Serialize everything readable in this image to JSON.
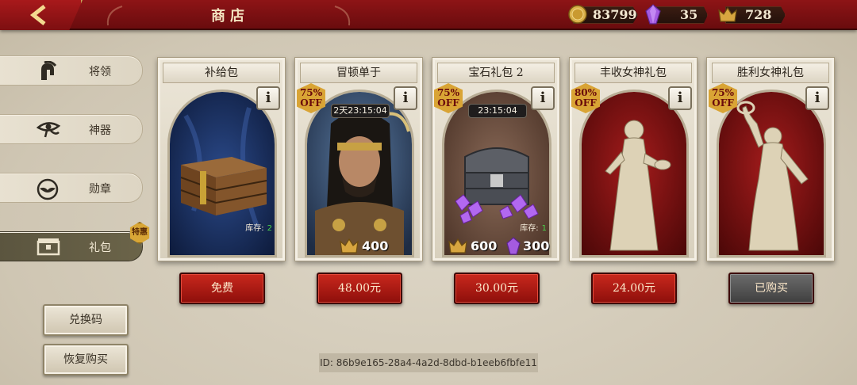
{
  "header": {
    "title": "商店",
    "currencies": [
      {
        "icon": "gold-coin-icon",
        "value": "83799"
      },
      {
        "icon": "purple-gem-icon",
        "value": "35"
      },
      {
        "icon": "crown-token-icon",
        "value": "728"
      }
    ]
  },
  "sidebar": {
    "items": [
      {
        "label": "将领",
        "icon": "spartan-helmet-icon"
      },
      {
        "label": "神器",
        "icon": "eye-of-horus-icon"
      },
      {
        "label": "勋章",
        "icon": "eagle-medal-icon"
      },
      {
        "label": "礼包",
        "icon": "gift-chest-icon"
      }
    ],
    "hot_badge": "特惠",
    "redeem_label": "兑换码",
    "restore_label": "恢复购买"
  },
  "cards": [
    {
      "title": "补给包",
      "art": "wooden-supply-chest",
      "stock_label": "库存:",
      "stock_value": "2",
      "button": "免费"
    },
    {
      "title": "冒顿单于",
      "art": "general-portrait",
      "off": "75%",
      "off_word": "OFF",
      "timer": "2天23:15:04",
      "reward_value": "400",
      "button": "48.00元"
    },
    {
      "title": "宝石礼包 2",
      "art": "gem-treasure-chest",
      "off": "75%",
      "off_word": "OFF",
      "timer": "23:15:04",
      "stock_label": "库存:",
      "stock_value": "1",
      "reward_value": "600",
      "gem_value": "300",
      "button": "30.00元"
    },
    {
      "title": "丰收女神礼包",
      "art": "harvest-goddess-statue",
      "off": "80%",
      "off_word": "OFF",
      "button": "24.00元"
    },
    {
      "title": "胜利女神礼包",
      "art": "victory-goddess-statue",
      "off": "75%",
      "off_word": "OFF",
      "button": "已购买"
    }
  ],
  "info_label": "i",
  "device_id": "ID: 86b9e165-28a4-4a2d-8dbd-b1eeb6fbfe11",
  "colors": {
    "top_bar": "#8e1416",
    "buy_button": "#c9281d",
    "bought_button": "#5a5a5a",
    "off_badge": "#d9a435",
    "stock_green": "#49d34a"
  }
}
